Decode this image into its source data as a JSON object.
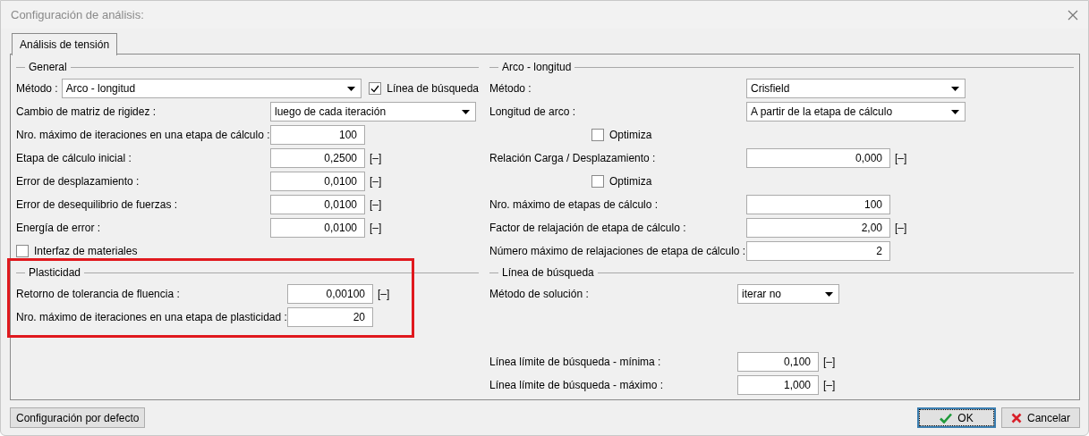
{
  "window": {
    "title": "Configuración de análisis:"
  },
  "tabs": [
    {
      "label": "Análisis de tensión",
      "selected": true
    }
  ],
  "columns": [
    {
      "sections": [
        {
          "title": "General",
          "rows": [
            {
              "kind": "select_check",
              "label": "Método :",
              "value": "Arco - longitud",
              "check_label": "Línea de búsqueda",
              "checked": true
            },
            {
              "kind": "select",
              "label": "Cambio de matriz de rigidez :",
              "value": "luego de cada iteración"
            },
            {
              "kind": "number",
              "label": "Nro. máximo de iteraciones en una etapa de cálculo :",
              "value": "100"
            },
            {
              "kind": "number",
              "label": "Etapa de cálculo inicial :",
              "value": "0,2500",
              "unit": "[–]"
            },
            {
              "kind": "number",
              "label": "Error de desplazamiento :",
              "value": "0,0100",
              "unit": "[–]"
            },
            {
              "kind": "number",
              "label": "Error de desequilibrio de fuerzas :",
              "value": "0,0100",
              "unit": "[–]"
            },
            {
              "kind": "number",
              "label": "Energía de error :",
              "value": "0,0100",
              "unit": "[–]"
            },
            {
              "kind": "checkbox",
              "label": "Interfaz de materiales",
              "checked": false
            }
          ]
        },
        {
          "title": "Plasticidad",
          "highlighted": true,
          "rows": [
            {
              "kind": "number",
              "label": "Retorno de tolerancia de fluencia :",
              "value": "0,00100",
              "unit": "[–]"
            },
            {
              "kind": "number",
              "label": "Nro. máximo de iteraciones en una etapa de plasticidad :",
              "value": "20"
            }
          ]
        }
      ]
    },
    {
      "sections": [
        {
          "title": "Arco - longitud",
          "rows": [
            {
              "kind": "select",
              "label": "Método :",
              "value": "Crisfield"
            },
            {
              "kind": "select",
              "label": "Longitud de arco :",
              "value": "A partir de la etapa de cálculo"
            },
            {
              "kind": "checkbox",
              "label": "Optimiza",
              "checked": false
            },
            {
              "kind": "number",
              "label": "Relación Carga / Desplazamiento :",
              "value": "0,000",
              "unit": "[–]"
            },
            {
              "kind": "checkbox",
              "label": "Optimiza",
              "checked": false
            },
            {
              "kind": "number",
              "label": "Nro. máximo de etapas de cálculo :",
              "value": "100"
            },
            {
              "kind": "number",
              "label": "Factor de relajación de etapa de cálculo :",
              "value": "2,00",
              "unit": "[–]"
            },
            {
              "kind": "number",
              "label": "Número máximo de relajaciones de etapa de cálculo :",
              "value": "2"
            }
          ]
        },
        {
          "title": "Línea de búsqueda",
          "rows": [
            {
              "kind": "select",
              "label": "Método de solución :",
              "value": "iterar no"
            },
            {
              "kind": "number",
              "label": "Línea límite de búsqueda - mínima :",
              "value": "0,100",
              "unit": "[–]"
            },
            {
              "kind": "number",
              "label": "Línea límite de búsqueda - máximo :",
              "value": "1,000",
              "unit": "[–]"
            }
          ]
        }
      ]
    }
  ],
  "default_button": "Configuración por defecto",
  "buttons": [
    {
      "kind": "ok",
      "label": "OK"
    },
    {
      "kind": "cancel",
      "label": "Cancelar"
    }
  ]
}
